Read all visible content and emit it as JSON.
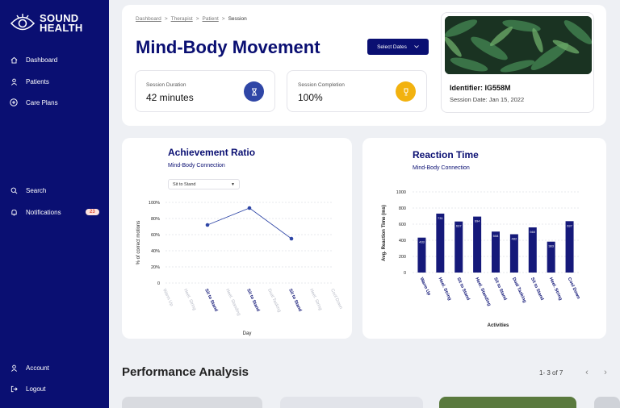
{
  "app": {
    "name_line1": "SOUND",
    "name_line2": "HEALTH"
  },
  "sidebar": {
    "items": [
      {
        "label": "Dashboard",
        "icon": "home-icon"
      },
      {
        "label": "Patients",
        "icon": "user-icon"
      },
      {
        "label": "Care Plans",
        "icon": "plus-circle-icon"
      },
      {
        "label": "Search",
        "icon": "search-icon"
      },
      {
        "label": "Notifications",
        "icon": "bell-icon",
        "badge": "23"
      },
      {
        "label": "Account",
        "icon": "user-icon"
      },
      {
        "label": "Logout",
        "icon": "logout-icon"
      }
    ]
  },
  "breadcrumb": {
    "items": [
      "Dashboard",
      "Therapist",
      "Patient"
    ],
    "current": "Session",
    "sep": ">"
  },
  "header": {
    "title": "Mind-Body Movement",
    "select_label": "Select Dates",
    "duration_label": "Session Duration",
    "duration_value": "42 minutes",
    "completion_label": "Session Completion",
    "completion_value": "100%",
    "duration_color": "#2f46a6",
    "completion_color": "#f2b20f"
  },
  "patient": {
    "identifier": "Identifier: IG558M",
    "session_date": "Session Date: Jan 15, 2022"
  },
  "achievement": {
    "title": "Achievement Ratio",
    "subtitle": "Mind-Body Connection",
    "dropdown_value": "Sit to Stand"
  },
  "reaction": {
    "title": "Reaction Time",
    "subtitle": "Mind-Body Connection"
  },
  "performance": {
    "title": "Performance Analysis",
    "pager": "1- 3 of 7"
  },
  "chart_data": [
    {
      "type": "line",
      "title": "Achievement Ratio",
      "ylabel": "% of correct motions",
      "xlabel": "Day",
      "ylim": [
        0,
        100
      ],
      "yticks": [
        "0",
        "20%",
        "40%",
        "60%",
        "80%",
        "100%"
      ],
      "categories": [
        "Warm Up",
        "Heel. String",
        "Sit to Stand",
        "Heel. Standing",
        "Sit to Stand",
        "Dual Tasking",
        "Sit to Stand",
        "Heel. String",
        "Cool Down"
      ],
      "highlight": [
        false,
        false,
        true,
        false,
        true,
        false,
        true,
        false,
        false
      ],
      "points": [
        {
          "index": 2,
          "value": 72
        },
        {
          "index": 4,
          "value": 93
        },
        {
          "index": 6,
          "value": 55
        }
      ],
      "color": "#2f46a6",
      "grid": true
    },
    {
      "type": "bar",
      "title": "Reaction Time",
      "ylabel": "Avg. Reaction Time (ms)",
      "xlabel": "Activities",
      "ylim": [
        0,
        1000
      ],
      "yticks": [
        "0",
        "200",
        "400",
        "600",
        "800",
        "1000"
      ],
      "categories": [
        "Warm Up",
        "Heel. String",
        "Sit to Stand",
        "Heel. Standing",
        "Sit to Stand",
        "Dual Tasking",
        "Sit to Stand",
        "Heel. String",
        "Cool Down"
      ],
      "values": [
        433,
        731,
        633,
        694,
        508,
        475,
        560,
        383,
        637
      ],
      "labels": [
        "433",
        "731",
        "637",
        "694",
        "508",
        "482",
        "560",
        "383",
        "637"
      ],
      "color": "#15197a",
      "grid": true
    }
  ]
}
